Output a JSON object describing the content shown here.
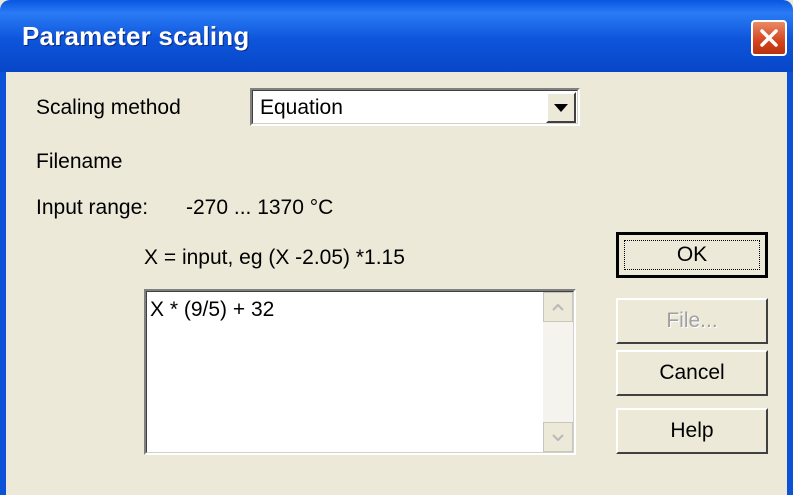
{
  "window": {
    "title": "Parameter scaling"
  },
  "icons": {
    "close": "close-icon",
    "dropdown": "chevron-down-icon",
    "scroll_up": "scroll-up-icon",
    "scroll_down": "scroll-down-icon"
  },
  "form": {
    "scaling_method_label": "Scaling method",
    "scaling_method_value": "Equation",
    "filename_label": "Filename",
    "input_range_label": "Input range:",
    "input_range_value": "-270 ... 1370 °C",
    "equation_hint": "X = input, eg (X -2.05) *1.15",
    "equation_text": "X * (9/5) + 32"
  },
  "buttons": {
    "ok": "OK",
    "file": "File...",
    "cancel": "Cancel",
    "help": "Help"
  },
  "colors": {
    "titlebar": "#0a56e0",
    "close": "#d4441d",
    "dialog_bg": "#ece9d8"
  }
}
